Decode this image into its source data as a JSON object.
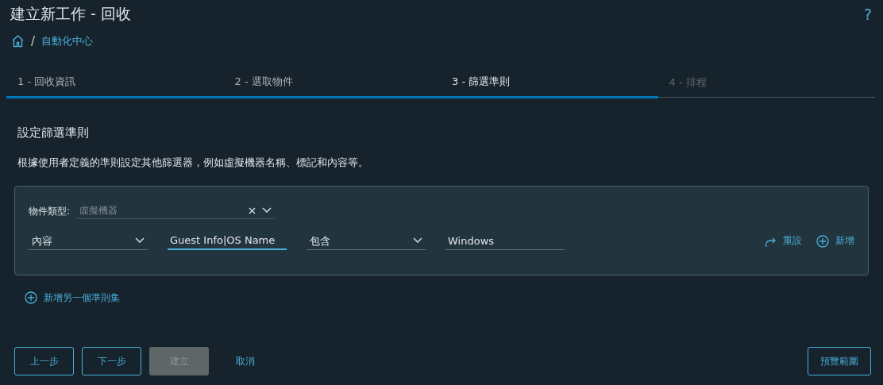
{
  "page": {
    "title": "建立新工作 - 回收",
    "help": "?"
  },
  "breadcrumb": {
    "separator": "/",
    "items": [
      {
        "label": "自動化中心"
      }
    ]
  },
  "steps": [
    {
      "label": "1 - 回收資訊",
      "completed": true,
      "selected": false
    },
    {
      "label": "2 - 選取物件",
      "completed": true,
      "selected": false
    },
    {
      "label": "3 - 篩選準則",
      "completed": true,
      "selected": true
    },
    {
      "label": "4 - 排程",
      "completed": false,
      "selected": false
    }
  ],
  "section": {
    "heading": "設定篩選準則",
    "description": "根據使用者定義的準則設定其他篩選器，例如虛擬機器名稱、標記和內容等。"
  },
  "criteria": {
    "object_type": {
      "label": "物件類型:",
      "placeholder": "虛擬機器"
    },
    "fields": [
      {
        "kind": "select",
        "value": "內容",
        "focused": false
      },
      {
        "kind": "input",
        "value": "Guest Info|OS Name",
        "focused": true
      },
      {
        "kind": "select",
        "value": "包含",
        "focused": false
      },
      {
        "kind": "input",
        "value": "Windows",
        "focused": false
      }
    ],
    "actions": [
      {
        "kind": "reset",
        "label": "重設"
      },
      {
        "kind": "add",
        "label": "新增"
      }
    ]
  },
  "add_ruleset": {
    "label": "新增另一個準則集"
  },
  "footer": {
    "buttons": [
      {
        "kind": "outline",
        "label": "上一步",
        "disabled": false
      },
      {
        "kind": "outline",
        "label": "下一步",
        "disabled": false
      },
      {
        "kind": "solid",
        "label": "建立",
        "disabled": true
      },
      {
        "kind": "link",
        "label": "取消",
        "disabled": false
      }
    ],
    "preview": {
      "label": "預覽範圍"
    }
  }
}
